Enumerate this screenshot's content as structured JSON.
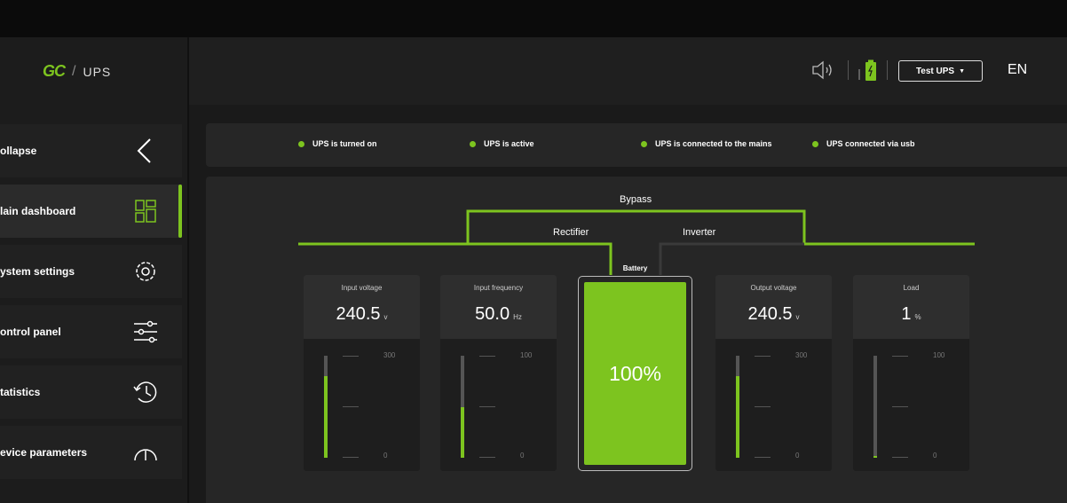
{
  "brand": {
    "mark": "GC",
    "slash": "/",
    "product": "UPS"
  },
  "sidebar": {
    "items": [
      {
        "label": "ollapse",
        "icon": "chevron-left-icon"
      },
      {
        "label": "lain dashboard",
        "icon": "dashboard-icon",
        "active": true
      },
      {
        "label": "ystem settings",
        "icon": "gear-icon"
      },
      {
        "label": "ontrol panel",
        "icon": "sliders-icon"
      },
      {
        "label": "tatistics",
        "icon": "history-icon"
      },
      {
        "label": "evice parameters",
        "icon": "gauge-icon"
      }
    ]
  },
  "header": {
    "speaker_icon": "speaker-icon",
    "battery_icon": "battery-charging-icon",
    "device_select": "Test UPS",
    "language": "EN"
  },
  "status": [
    {
      "label": "UPS is turned on"
    },
    {
      "label": "UPS is active"
    },
    {
      "label": "UPS is connected to the mains"
    },
    {
      "label": "UPS connected via usb"
    }
  ],
  "flow": {
    "bypass": "Bypass",
    "rectifier": "Rectifier",
    "inverter": "Inverter",
    "battery": "Battery",
    "accent": "#7dc41f"
  },
  "gauges": [
    {
      "title": "Input voltage",
      "value": "240.5",
      "unit": "v",
      "max": "300",
      "min": "0",
      "fraction": 0.8
    },
    {
      "title": "Input frequency",
      "value": "50.0",
      "unit": "Hz",
      "max": "100",
      "min": "0",
      "fraction": 0.5
    },
    {
      "title": "Output voltage",
      "value": "240.5",
      "unit": "v",
      "max": "300",
      "min": "0",
      "fraction": 0.8
    },
    {
      "title": "Load",
      "value": "1",
      "unit": "%",
      "max": "100",
      "min": "0",
      "fraction": 0.01
    }
  ],
  "battery": {
    "percent_label": "100%",
    "fraction": 1.0
  }
}
